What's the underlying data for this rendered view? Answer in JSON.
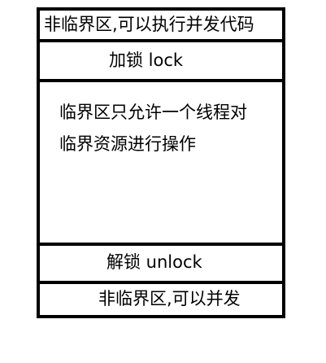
{
  "diagram": {
    "sections": {
      "non_critical_top": "非临界区,可以执行并发代码",
      "lock": "加锁   lock",
      "critical_line1": "临界区只允许一个线程对",
      "critical_line2": "临界资源进行操作",
      "unlock": "解锁  unlock",
      "non_critical_bottom": "非临界区,可以并发"
    }
  }
}
